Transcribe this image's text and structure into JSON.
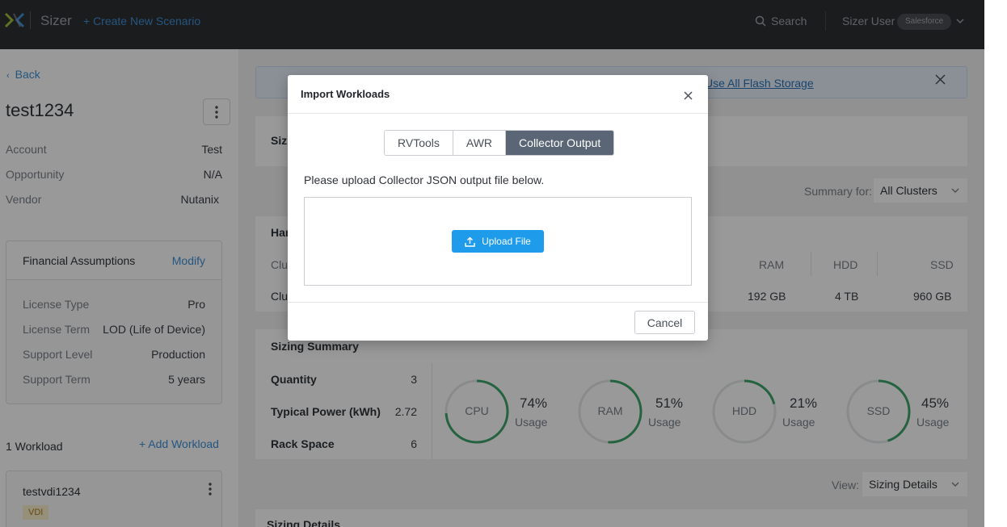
{
  "header": {
    "brand": "Sizer",
    "create_label": "+ Create New Scenario",
    "search_label": "Search",
    "user_name": "Sizer User",
    "org_badge": "Salesforce"
  },
  "sidebar": {
    "back_label": "Back",
    "scenario_name": "test1234",
    "meta": [
      {
        "key": "Account",
        "value": "Test"
      },
      {
        "key": "Opportunity",
        "value": "N/A"
      },
      {
        "key": "Vendor",
        "value": "Nutanix"
      }
    ],
    "financial": {
      "title": "Financial Assumptions",
      "modify_label": "Modify",
      "rows": [
        {
          "key": "License Type",
          "value": "Pro"
        },
        {
          "key": "License Term",
          "value": "LOD (Life of Device)"
        },
        {
          "key": "Support Level",
          "value": "Production"
        },
        {
          "key": "Support Term",
          "value": "5 years"
        }
      ]
    },
    "workload_count": "1 Workload",
    "add_workload_label": "+ Add Workload",
    "workload": {
      "name": "testvdi1234",
      "badge": "VDI"
    }
  },
  "main": {
    "banner_link": "Use All Flash Storage",
    "sizing_label": "Sizi",
    "summary_for_label": "Summary for:",
    "summary_for_value": "All Clusters",
    "hardware_label": "Har",
    "cluster_header_stub": "Clu",
    "cluster_row_stub": "Clu",
    "hw_headers": [
      "RAM",
      "HDD",
      "SSD"
    ],
    "hw_values": [
      "192 GB",
      "4 TB",
      "960 GB"
    ],
    "sizing_summary_title": "Sizing Summary",
    "summary_rows": [
      {
        "key": "Quantity",
        "value": "3"
      },
      {
        "key": "Typical Power (kWh)",
        "value": "2.72"
      },
      {
        "key": "Rack Space",
        "value": "6"
      }
    ],
    "usage_label": "Usage",
    "gauges": [
      {
        "name": "CPU",
        "pct_label": "74%",
        "value": 0.74
      },
      {
        "name": "RAM",
        "pct_label": "51%",
        "value": 0.51
      },
      {
        "name": "HDD",
        "pct_label": "21%",
        "value": 0.21
      },
      {
        "name": "SSD",
        "pct_label": "45%",
        "value": 0.45
      }
    ],
    "view_label": "View:",
    "view_value": "Sizing Details",
    "sizing_details_title": "Sizing Details"
  },
  "modal": {
    "title": "Import Workloads",
    "tabs": [
      {
        "label": "RVTools",
        "active": false
      },
      {
        "label": "AWR",
        "active": false
      },
      {
        "label": "Collector Output",
        "active": true
      }
    ],
    "instruction": "Please upload Collector JSON output file below.",
    "upload_label": "Upload File",
    "cancel_label": "Cancel"
  },
  "colors": {
    "accent": "#3e8fd6",
    "upload_button": "#1e9bea",
    "gauge": "#3fa66b",
    "active_tab": "#5a6676"
  }
}
